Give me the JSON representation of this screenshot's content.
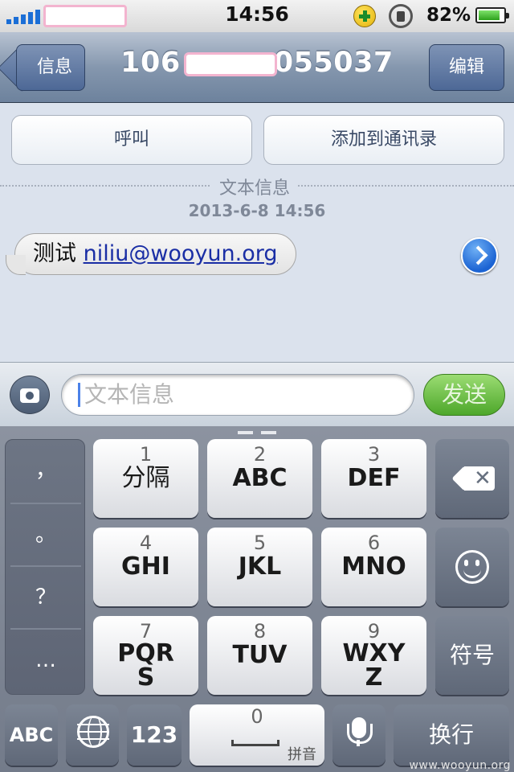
{
  "status_bar": {
    "time": "14:56",
    "battery_percent": "82%",
    "battery_level": 0.82,
    "signal_bars": 5
  },
  "nav": {
    "back_label": "信息",
    "title_prefix": "106",
    "title_suffix": "055037",
    "edit_label": "编辑"
  },
  "conversation": {
    "call_label": "呼叫",
    "add_contact_label": "添加到通讯录",
    "message_type": "文本信息",
    "timestamp": "2013-6-8 14:56",
    "message_text": "测试",
    "message_link": "niliu@wooyun.org"
  },
  "composer": {
    "placeholder": "文本信息",
    "send_label": "发送"
  },
  "keyboard": {
    "punctuation": [
      "，",
      "。",
      "？",
      "…"
    ],
    "keys": [
      {
        "num": "1",
        "letters": "分隔"
      },
      {
        "num": "2",
        "letters": "ABC"
      },
      {
        "num": "3",
        "letters": "DEF"
      },
      {
        "num": "4",
        "letters": "GHI"
      },
      {
        "num": "5",
        "letters": "JKL"
      },
      {
        "num": "6",
        "letters": "MNO"
      },
      {
        "num": "7",
        "letters": "PQR\nS"
      },
      {
        "num": "8",
        "letters": "TUV"
      },
      {
        "num": "9",
        "letters": "WXY\nZ"
      }
    ],
    "symbols_label": "符号",
    "abc_label": "ABC",
    "num_label": "123",
    "space_num": "0",
    "space_label": "拼音",
    "return_label": "换行"
  },
  "watermark": "www.wooyun.org"
}
